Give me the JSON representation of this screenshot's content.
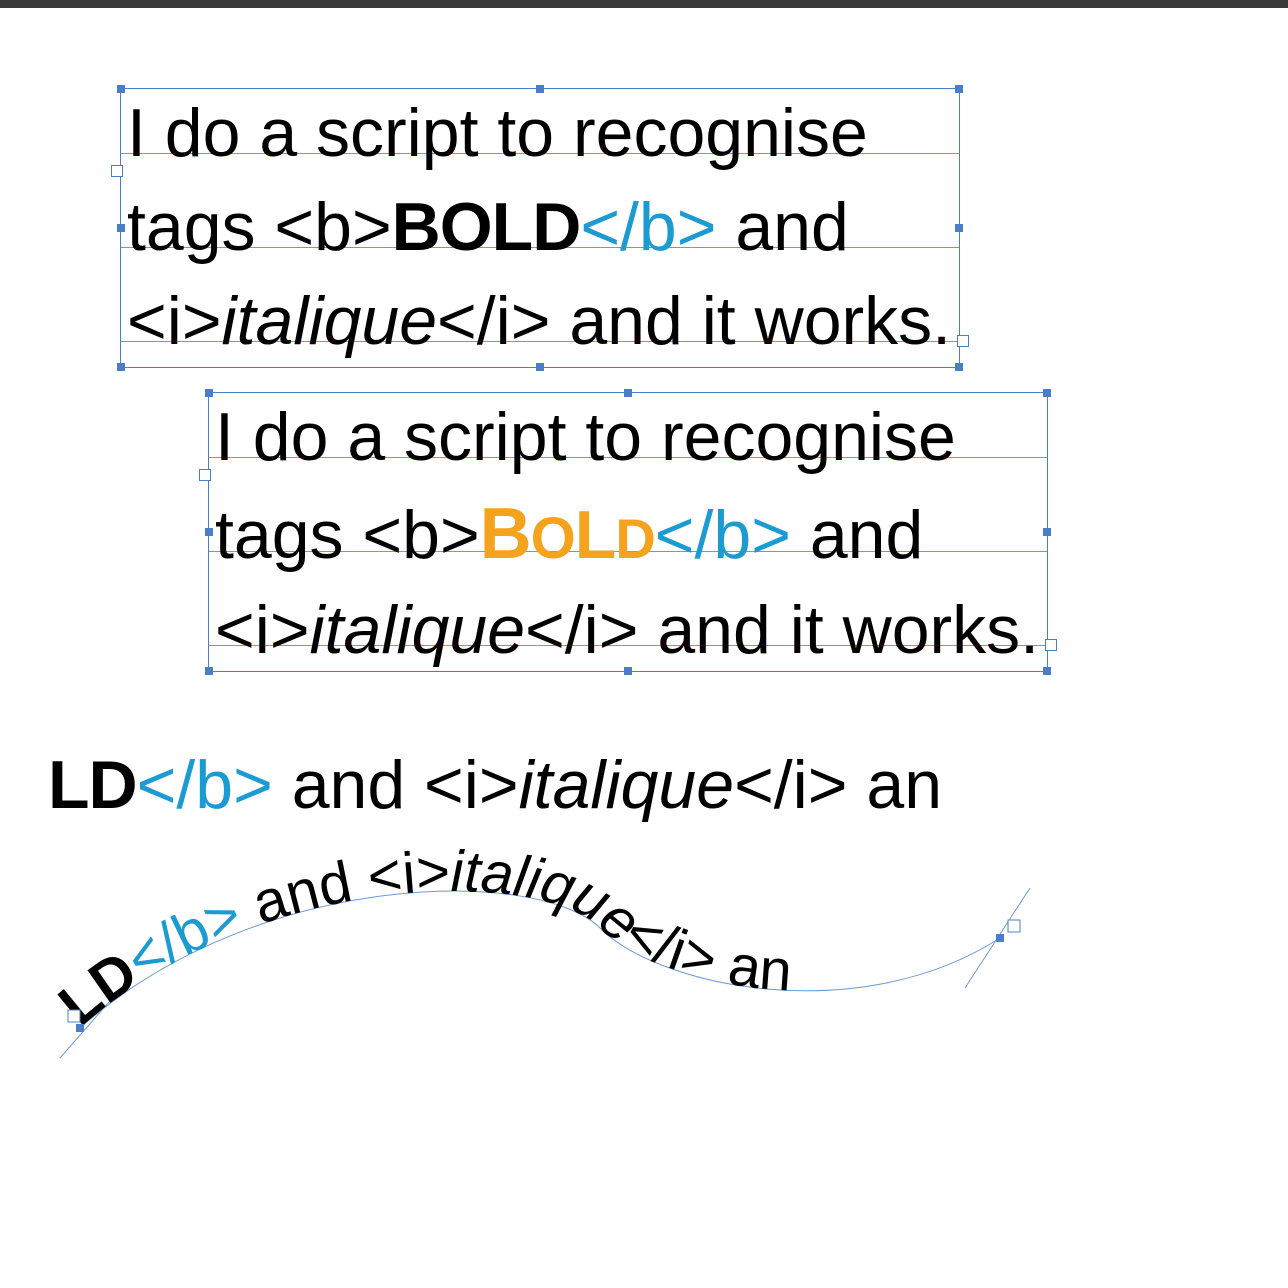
{
  "colors": {
    "selection_blue": "#4a7ec8",
    "tag_close_blue": "#1b9bd1",
    "bold_orange": "#f5a31e",
    "black": "#000000"
  },
  "frame1": {
    "line1": "I do a script to recognise",
    "line2_pre": "tags ",
    "line2_tag_open": "<b>",
    "line2_bold": "BOLD",
    "line2_tag_close": "</b>",
    "line2_post": " and",
    "line3_tag_open": "<i>",
    "line3_italic": "italique",
    "line3_tag_close": "</i>",
    "line3_post": " and it works."
  },
  "frame2": {
    "line1": "I do a script to recognise",
    "line2_pre": "tags ",
    "line2_tag_open": "<b>",
    "line2_bold_c1": "B",
    "line2_bold_c2": "O",
    "line2_bold_c3": "L",
    "line2_bold_c4": "D",
    "line2_tag_close": "</b>",
    "line2_post": " and",
    "line3_tag_open": "<i>",
    "line3_italic": "italique",
    "line3_tag_close": "</i>",
    "line3_post": " and it works."
  },
  "line3block": {
    "bold_part": "LD",
    "tag_close_b": "</b>",
    "mid": " and ",
    "tag_open_i": "<i>",
    "italic": "italique",
    "tag_close_i": "</i>",
    "post": " an"
  },
  "path_text": {
    "bold_part": "LD",
    "tag_close_b": "</b>",
    "mid": " and ",
    "tag_open_i": "<i>",
    "italic": "italique",
    "tag_close_i": "</i>",
    "post": " an"
  }
}
